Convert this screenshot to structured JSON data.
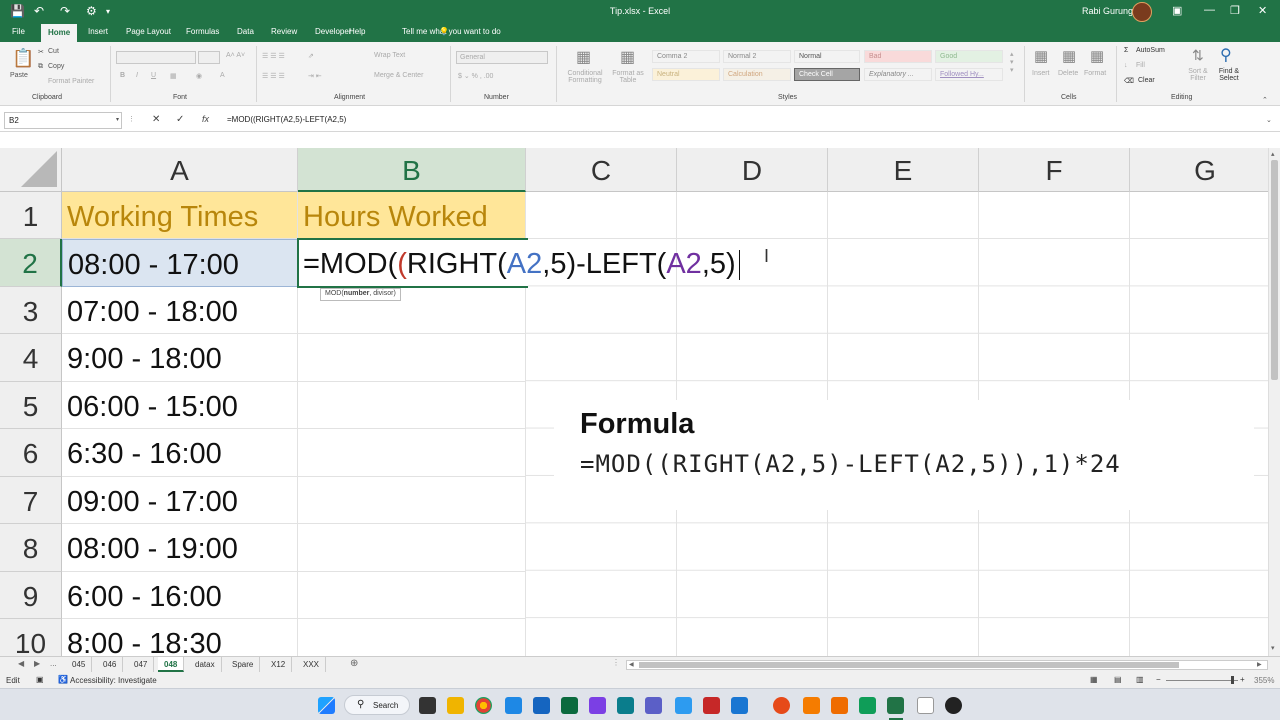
{
  "title_bar": {
    "document": "Tip.xlsx  -  Excel",
    "user": "Rabi Gurung"
  },
  "ribbon_tabs": [
    "File",
    "Home",
    "Insert",
    "Page Layout",
    "Formulas",
    "Data",
    "Review",
    "Developer",
    "Help",
    "Tell me what you want to do"
  ],
  "active_tab": "Home",
  "clipboard": {
    "paste": "Paste",
    "cut": "Cut",
    "copy": "Copy",
    "format_painter": "Format Painter",
    "label": "Clipboard"
  },
  "font_group": {
    "label": "Font"
  },
  "alignment": {
    "wrap": "Wrap Text",
    "merge": "Merge & Center",
    "label": "Alignment"
  },
  "number": {
    "format": "General",
    "label": "Number"
  },
  "styles": {
    "conditional": "Conditional Formatting",
    "format_table": "Format as Table",
    "cells": [
      "Comma 2",
      "Normal 2",
      "Normal",
      "Bad",
      "Good",
      "Neutral",
      "Calculation",
      "Check Cell",
      "Explanatory ...",
      "Followed Hy..."
    ],
    "label": "Styles"
  },
  "cells_group": {
    "insert": "Insert",
    "delete": "Delete",
    "format": "Format",
    "label": "Cells"
  },
  "editing": {
    "autosum": "AutoSum",
    "fill": "Fill",
    "clear": "Clear",
    "sort": "Sort & Filter",
    "find": "Find & Select",
    "label": "Editing"
  },
  "formula_bar": {
    "name_box": "B2",
    "formula": "=MOD((RIGHT(A2,5)-LEFT(A2,5)"
  },
  "columns": [
    "A",
    "B",
    "C",
    "D",
    "E",
    "F",
    "G"
  ],
  "rows": [
    "1",
    "2",
    "3",
    "4",
    "5",
    "6",
    "7",
    "8",
    "9",
    "10"
  ],
  "cells": {
    "A1": "Working Times",
    "B1": "Hours Worked",
    "A2": "08:00 - 17:00",
    "A3": "07:00 - 18:00",
    "A4": "9:00 - 18:00",
    "A5": "06:00 - 15:00",
    "A6": "6:30 - 16:00",
    "A7": "09:00 - 17:00",
    "A8": "08:00 - 19:00",
    "A9": "6:00 - 16:00",
    "A10": "8:00 - 18:30"
  },
  "edit_formula_parts": [
    "=MOD(",
    "(",
    "RIGHT(",
    "A2",
    ",5)",
    "-LEFT(",
    "A2",
    ",5)"
  ],
  "tooltip": {
    "func": "MOD(",
    "arg": "number",
    ",rest": ", divisor)"
  },
  "overlay": {
    "heading": "Formula",
    "formula": "=MOD((RIGHT(A2,5)-LEFT(A2,5)),1)*24"
  },
  "sheet_tabs": [
    "045",
    "046",
    "047",
    "048",
    "datax",
    "Spare",
    "X12",
    "XXX"
  ],
  "active_sheet": "048",
  "status": {
    "mode": "Edit",
    "accessibility": "Accessibility: Investigate",
    "zoom": "355%"
  },
  "taskbar": {
    "search": "Search"
  },
  "colors": {
    "excel_green": "#217346",
    "header_fill": "#ffe699",
    "header_text": "#b8860b",
    "ref_blue": "#4472c4",
    "paren_purple": "#7030a0"
  }
}
